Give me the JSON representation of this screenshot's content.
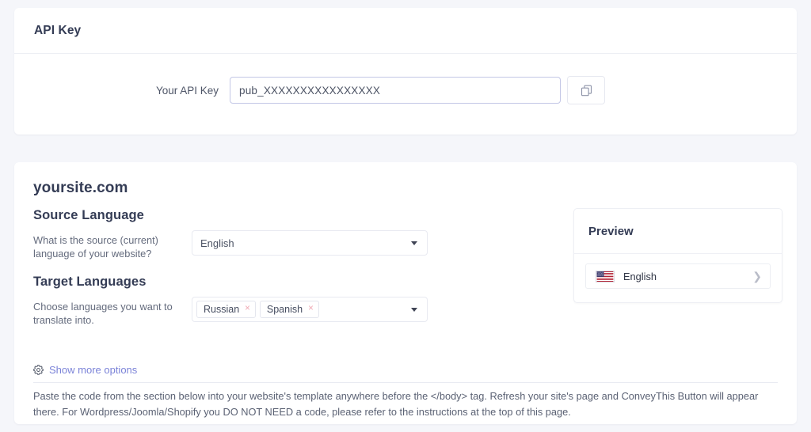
{
  "api_card": {
    "title": "API Key",
    "field_label": "Your API Key",
    "api_key_value": "pub_XXXXXXXXXXXXXXXX",
    "api_key_placeholder": "pub_",
    "copy_icon": "copy-icon",
    "input_border_color": "#c3c7e6"
  },
  "settings_card": {
    "site_title": "yoursite.com",
    "source": {
      "heading": "Source Language",
      "description": "What is the source (current) language of your website?",
      "selected": "English",
      "caret_icon": "chevron-down-icon"
    },
    "target": {
      "heading": "Target Languages",
      "description": "Choose languages you want to translate into.",
      "tags": [
        {
          "label": "Russian",
          "remove": "×"
        },
        {
          "label": "Spanish",
          "remove": "×"
        }
      ],
      "caret_icon": "chevron-down-icon"
    },
    "more_options": {
      "icon": "gear-icon",
      "label": "Show more options",
      "link_color": "#7b83d8"
    },
    "footer_text": "Paste the code from the section below into your website's template anywhere before the </body> tag. Refresh your site's page and ConveyThis Button will appear there. For Wordpress/Joomla/Shopify you DO NOT NEED a code, please refer to the instructions at the top of this page."
  },
  "preview": {
    "title": "Preview",
    "language": {
      "flag_icon": "us-flag-icon",
      "name": "English",
      "chevron_icon": "chevron-right-icon",
      "chevron_glyph": "❯"
    }
  },
  "theme": {
    "page_background": "#f5f6fa",
    "card_background": "#ffffff",
    "heading_color": "#343c55",
    "accent_link": "#7b83d8",
    "tag_remove_color": "#f0a9b4"
  }
}
